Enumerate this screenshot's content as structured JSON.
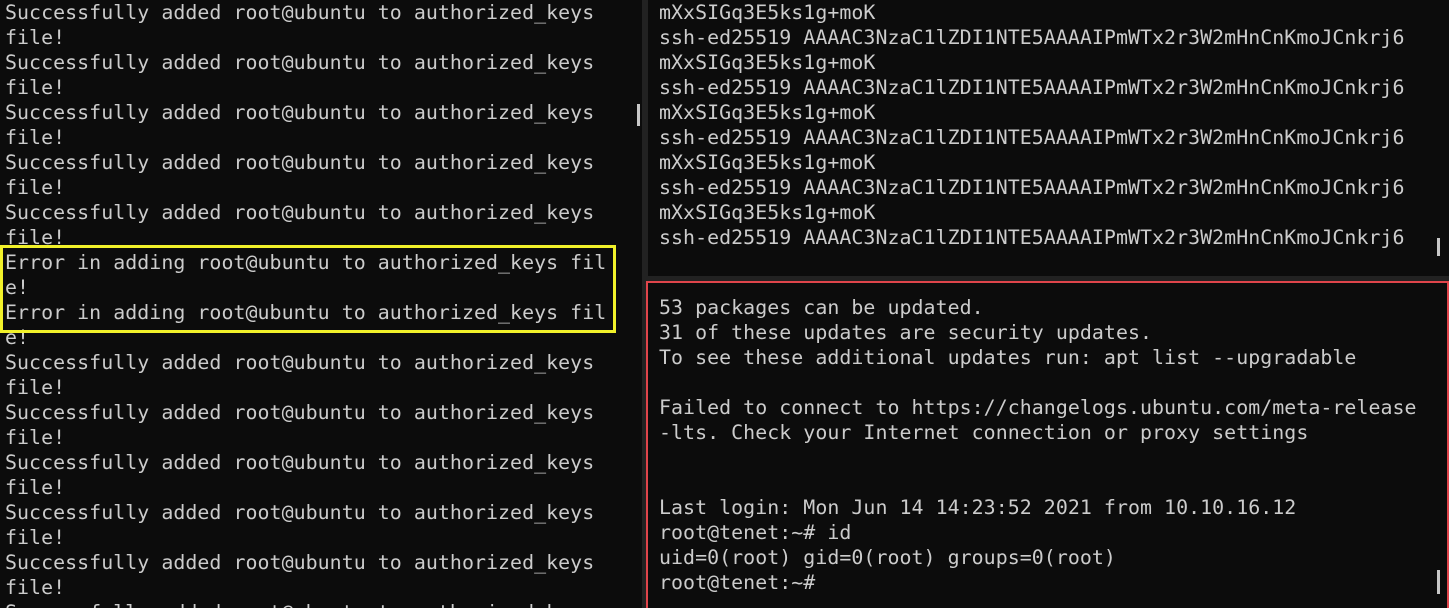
{
  "left_pane": {
    "lines": [
      "Successfully added root@ubuntu to authorized_keys",
      "file!",
      "Successfully added root@ubuntu to authorized_keys",
      "file!",
      "Successfully added root@ubuntu to authorized_keys",
      "file!",
      "Successfully added root@ubuntu to authorized_keys",
      "file!",
      "Successfully added root@ubuntu to authorized_keys",
      "file!",
      "Error in adding root@ubuntu to authorized_keys fil",
      "e!",
      "Error in adding root@ubuntu to authorized_keys fil",
      "e!",
      "Successfully added root@ubuntu to authorized_keys",
      "file!",
      "Successfully added root@ubuntu to authorized_keys",
      "file!",
      "Successfully added root@ubuntu to authorized_keys",
      "file!",
      "Successfully added root@ubuntu to authorized_keys",
      "file!",
      "Successfully added root@ubuntu to authorized_keys",
      "file!",
      "Successfully added root@ubuntu to authorized_keys"
    ],
    "highlight_color": "#f1f12a"
  },
  "top_right_pane": {
    "lines": [
      "mXxSIGq3E5ks1g+moK",
      "ssh-ed25519 AAAAC3NzaC1lZDI1NTE5AAAAIPmWTx2r3W2mHnCnKmoJCnkrj6",
      "mXxSIGq3E5ks1g+moK",
      "ssh-ed25519 AAAAC3NzaC1lZDI1NTE5AAAAIPmWTx2r3W2mHnCnKmoJCnkrj6",
      "mXxSIGq3E5ks1g+moK",
      "ssh-ed25519 AAAAC3NzaC1lZDI1NTE5AAAAIPmWTx2r3W2mHnCnKmoJCnkrj6",
      "mXxSIGq3E5ks1g+moK",
      "ssh-ed25519 AAAAC3NzaC1lZDI1NTE5AAAAIPmWTx2r3W2mHnCnKmoJCnkrj6",
      "mXxSIGq3E5ks1g+moK",
      "ssh-ed25519 AAAAC3NzaC1lZDI1NTE5AAAAIPmWTx2r3W2mHnCnKmoJCnkrj6"
    ]
  },
  "bottom_right_pane": {
    "lines": [
      "53 packages can be updated.",
      "31 of these updates are security updates.",
      "To see these additional updates run: apt list --upgradable",
      "",
      "Failed to connect to https://changelogs.ubuntu.com/meta-release",
      "-lts. Check your Internet connection or proxy settings",
      "",
      "",
      "Last login: Mon Jun 14 14:23:52 2021 from 10.10.16.12",
      "root@tenet:~# id",
      "uid=0(root) gid=0(root) groups=0(root)",
      "root@tenet:~#"
    ],
    "border_color": "#e0454b"
  },
  "colors": {
    "background": "#0c0c0c",
    "text": "#cccccc"
  }
}
